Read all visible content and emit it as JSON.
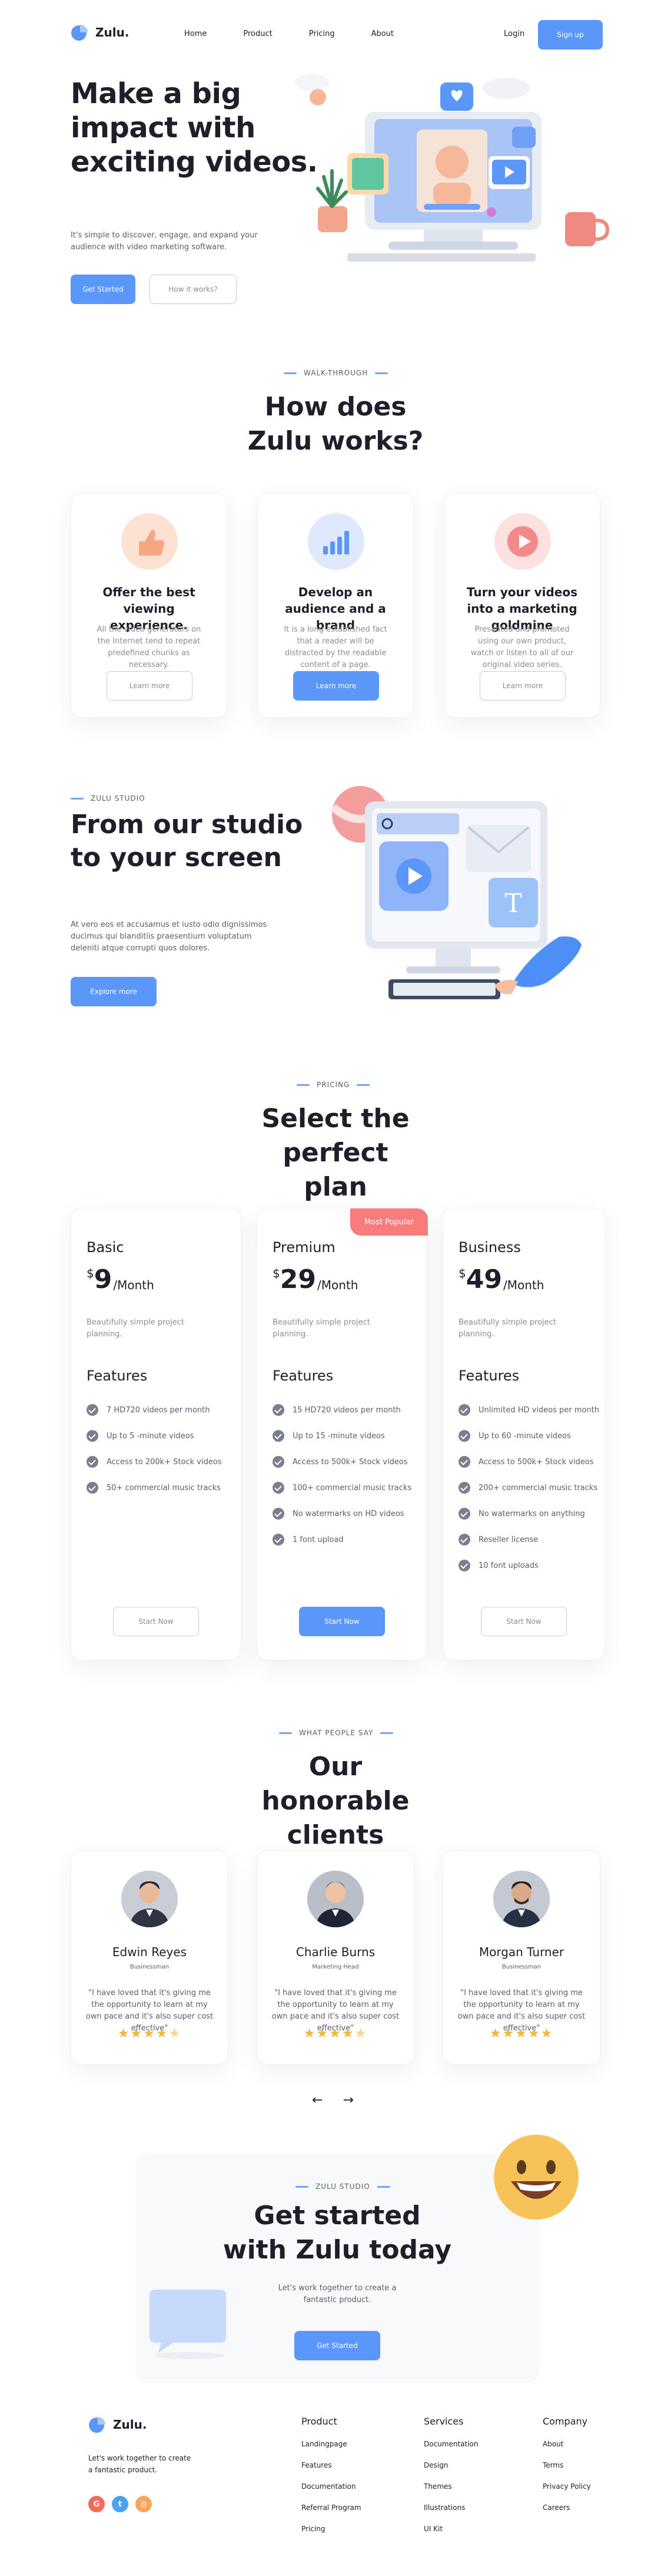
{
  "brand": {
    "name": "Zulu.",
    "accent": "#5b97f9"
  },
  "nav": {
    "items": [
      "Home",
      "Product",
      "Pricing",
      "About"
    ],
    "login": "Login",
    "signup": "Sign up"
  },
  "hero": {
    "title": "Make a big impact with exciting videos.",
    "description": "It's simple to discover, engage, and expand your audience with video marketing software.",
    "primary_btn": "Get Started",
    "secondary_btn": "How it works?"
  },
  "walkthrough": {
    "eyebrow": "WALK-THROUGH",
    "title": "How does Zulu works?",
    "cards": [
      {
        "icon": "thumbs-up-icon",
        "title": "Offer the best viewing experience.",
        "text": "All the video generators on the Internet tend to repeat predefined chunks as necessary.",
        "button": "Learn more"
      },
      {
        "icon": "bar-chart-icon",
        "title": "Develop an audience and a brand",
        "text": "It is a long established fact that a reader will be distracted by the readable content of a page.",
        "button": "Learn more"
      },
      {
        "icon": "play-icon",
        "title": "Turn your videos into a marketing goldmine",
        "text": "Presented and promoted using our own product, watch or listen to all of our original video series.",
        "button": "Learn more"
      }
    ]
  },
  "studio": {
    "eyebrow": "ZULU STUDIO",
    "title": "From our studio to your screen",
    "description": "At vero eos et accusamus et iusto odio dignissimos ducimus qui blanditiis praesentium voluptatum deleniti atque corrupti quos dolores.",
    "button": "Explore more"
  },
  "pricing": {
    "eyebrow": "PRICING",
    "title": "Select the perfect plan",
    "features_heading": "Features",
    "plans": [
      {
        "name": "Basic",
        "currency": "$",
        "price": "9",
        "period": "/Month",
        "desc": "Beautifully simple project planning.",
        "badge": "",
        "button": "Start Now",
        "features": [
          "7 HD720 videos per month",
          "Up to 5 -minute videos",
          "Access to 200k+ Stock videos",
          "50+ commercial music tracks"
        ]
      },
      {
        "name": "Premium",
        "currency": "$",
        "price": "29",
        "period": "/Month",
        "desc": "Beautifully simple project planning.",
        "badge": "Most Popular",
        "button": "Start Now",
        "features": [
          "15 HD720 videos per month",
          "Up to 15 -minute videos",
          "Access to 500k+ Stock videos",
          "100+ commercial music tracks",
          "No watermarks on HD videos",
          "1 font upload"
        ]
      },
      {
        "name": "Business",
        "currency": "$",
        "price": "49",
        "period": "/Month",
        "desc": "Beautifully simple project planning.",
        "badge": "",
        "button": "Start Now",
        "features": [
          "Unlimited HD videos per month",
          "Up to 60 -minute videos",
          "Access to 500k+ Stock videos",
          "200+ commercial music tracks",
          "No watermarks on anything",
          "Reseller license",
          "10 font uploads"
        ]
      }
    ]
  },
  "testimonials": {
    "eyebrow": "WHAT PEOPLE SAY",
    "title": "Our honorable clients",
    "items": [
      {
        "name": "Edwin Reyes",
        "role": "Businessman",
        "quote": "\"I have loved that it's giving me the opportunity to learn at my own pace and it's also super cost effective\"",
        "rating": 4.5
      },
      {
        "name": "Charlie Burns",
        "role": "Marketing Head",
        "quote": "\"I have loved that it's giving me the opportunity to learn at my own pace and it's also super cost effective\"",
        "rating": 4.5
      },
      {
        "name": "Morgan Turner",
        "role": "Businessman",
        "quote": "\"I have loved that it's giving me the opportunity to learn at my own pace and it's also super cost effective\"",
        "rating": 5
      }
    ],
    "prev": "←",
    "next": "→"
  },
  "cta": {
    "eyebrow": "ZULU STUDIO",
    "title": "Get started with Zulu today",
    "description": "Let's work together to create a fantastic product.",
    "button": "Get Started"
  },
  "footer": {
    "tagline": "Let's work together to create a fantastic product.",
    "socials": [
      {
        "icon": "google-icon",
        "glyph": "G",
        "color": "#f26b5b"
      },
      {
        "icon": "twitter-icon",
        "glyph": "t",
        "color": "#4aa3f0"
      },
      {
        "icon": "instagram-icon",
        "glyph": "◎",
        "color": "#f7a65b"
      }
    ],
    "columns": [
      {
        "title": "Product",
        "links": [
          "Landingpage",
          "Features",
          "Documentation",
          "Referral Program",
          "Pricing"
        ]
      },
      {
        "title": "Services",
        "links": [
          "Documentation",
          "Design",
          "Themes",
          "Illustrations",
          "UI Kit"
        ]
      },
      {
        "title": "Company",
        "links": [
          "About",
          "Terms",
          "Privacy Policy",
          "Careers"
        ]
      }
    ]
  }
}
